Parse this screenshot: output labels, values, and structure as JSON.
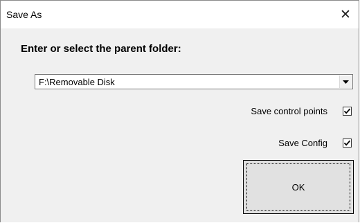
{
  "window": {
    "title": "Save As",
    "close_glyph": "✕"
  },
  "form": {
    "prompt": "Enter or select the parent folder:",
    "folder_value": "F:\\Removable Disk",
    "save_control_points_label": "Save control points",
    "save_control_points_checked": true,
    "save_config_label": "Save Config",
    "save_config_checked": true,
    "ok_label": "OK"
  }
}
